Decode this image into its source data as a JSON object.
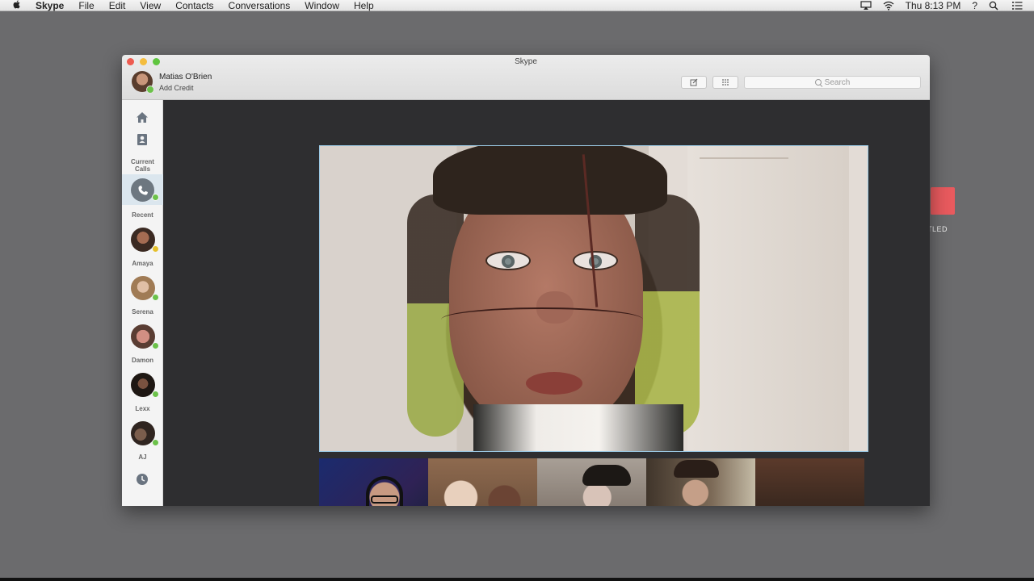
{
  "menubar": {
    "app_name": "Skype",
    "menus": [
      "File",
      "Edit",
      "View",
      "Contacts",
      "Conversations",
      "Window",
      "Help"
    ],
    "clock": "Thu 8:13 PM",
    "help_glyph": "?"
  },
  "desktop": {
    "icon_label": "TLED",
    "icon_color": "#e85a5e"
  },
  "window": {
    "title": "Skype",
    "profile_name": "Matias O'Brien",
    "profile_subtitle": "Add Credit",
    "search_placeholder": "Search"
  },
  "sidebar": {
    "current_calls_label": "Current\nCalls",
    "recent_label": "Recent",
    "contacts": [
      {
        "name": "Amaya",
        "status": "away",
        "status_color": "#e5c02c"
      },
      {
        "name": "Serena",
        "status": "online",
        "status_color": "#6cc24a"
      },
      {
        "name": "Damon",
        "status": "online",
        "status_color": "#6cc24a"
      },
      {
        "name": "Lexx",
        "status": "online",
        "status_color": "#6cc24a"
      },
      {
        "name": "AJ",
        "status": "online",
        "status_color": "#6cc24a"
      }
    ]
  },
  "colors": {
    "accent_online": "#6cc24a",
    "active_video_border": "#9bc9e4"
  }
}
